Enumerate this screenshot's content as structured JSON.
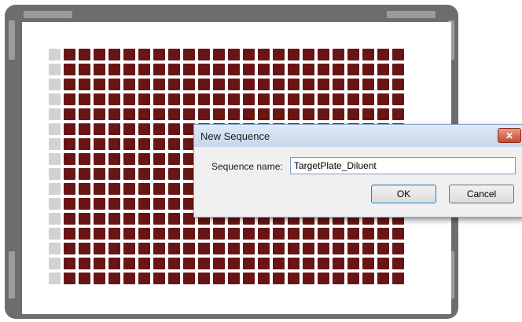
{
  "plate": {
    "rows": 16,
    "columns": 24,
    "empty_columns": [
      1
    ],
    "filled_color": "#6a1515",
    "empty_color": "#d2d2d2"
  },
  "dialog": {
    "title": "New Sequence",
    "close_symbol": "✕",
    "sequence_label": "Sequence name:",
    "sequence_value": "TargetPlate_Diluent",
    "ok_label": "OK",
    "cancel_label": "Cancel"
  }
}
